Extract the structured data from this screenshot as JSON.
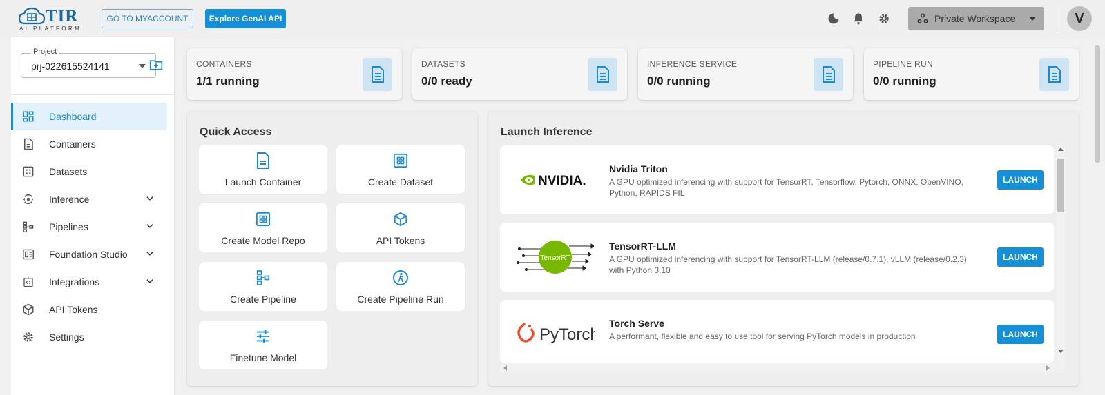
{
  "header": {
    "logo_text": "TIR",
    "logo_sub": "AI PLATFORM",
    "myaccount_label": "GO TO MYACCOUNT",
    "genai_label": "Explore GenAI API",
    "workspace_label": "Private Workspace",
    "avatar_initial": "V",
    "icons": [
      "moon-icon",
      "bell-icon",
      "gear-icon"
    ]
  },
  "sidebar": {
    "project_label": "Project",
    "project_value": "prj-022615524141",
    "items": [
      {
        "label": "Dashboard",
        "icon": "dashboard-icon",
        "active": true
      },
      {
        "label": "Containers",
        "icon": "file-icon"
      },
      {
        "label": "Datasets",
        "icon": "grid-icon"
      },
      {
        "label": "Inference",
        "icon": "inference-icon",
        "expandable": true
      },
      {
        "label": "Pipelines",
        "icon": "pipeline-icon",
        "expandable": true
      },
      {
        "label": "Foundation Studio",
        "icon": "studio-icon",
        "expandable": true
      },
      {
        "label": "Integrations",
        "icon": "integrations-icon",
        "expandable": true
      },
      {
        "label": "API Tokens",
        "icon": "cube-icon"
      },
      {
        "label": "Settings",
        "icon": "settings-icon"
      }
    ]
  },
  "stats": [
    {
      "label": "CONTAINERS",
      "value": "1/1 running"
    },
    {
      "label": "DATASETS",
      "value": "0/0 ready"
    },
    {
      "label": "INFERENCE SERVICE",
      "value": "0/0 running"
    },
    {
      "label": "PIPELINE RUN",
      "value": "0/0 running"
    }
  ],
  "quick_access": {
    "title": "Quick Access",
    "tiles": [
      {
        "label": "Launch Container",
        "icon": "file-icon"
      },
      {
        "label": "Create Dataset",
        "icon": "grid-icon"
      },
      {
        "label": "Create Model Repo",
        "icon": "grid-icon"
      },
      {
        "label": "API Tokens",
        "icon": "cube-icon"
      },
      {
        "label": "Create Pipeline",
        "icon": "pipeline-icon"
      },
      {
        "label": "Create Pipeline Run",
        "icon": "run-icon"
      },
      {
        "label": "Finetune Model",
        "icon": "sliders-icon"
      }
    ]
  },
  "launch_inference": {
    "title": "Launch Inference",
    "launch_label": "LAUNCH",
    "cards": [
      {
        "name": "Nvidia Triton",
        "logo_text": "NVIDIA.",
        "desc": "A GPU optimized inferencing with support for TensorRT, Tensorflow, Pytorch, ONNX, OpenVINO, Python, RAPIDS FIL"
      },
      {
        "name": "TensorRT-LLM",
        "logo_text": "TensorRT",
        "desc": "A GPU optimized inferencing with support for TensorRT-LLM (release/0.7.1), vLLM (release/0.2.3) with Python 3.10"
      },
      {
        "name": "Torch Serve",
        "logo_text": "PyTorch",
        "desc": "A performant, flexible and easy to use tool for serving PyTorch models in production"
      }
    ]
  },
  "colors": {
    "accent": "#1590d6",
    "active_bg": "#e2f1fb",
    "icon_tile": "#cfe4f2",
    "nvidia_green": "#76b900",
    "pytorch_orange": "#ee4c2c"
  }
}
